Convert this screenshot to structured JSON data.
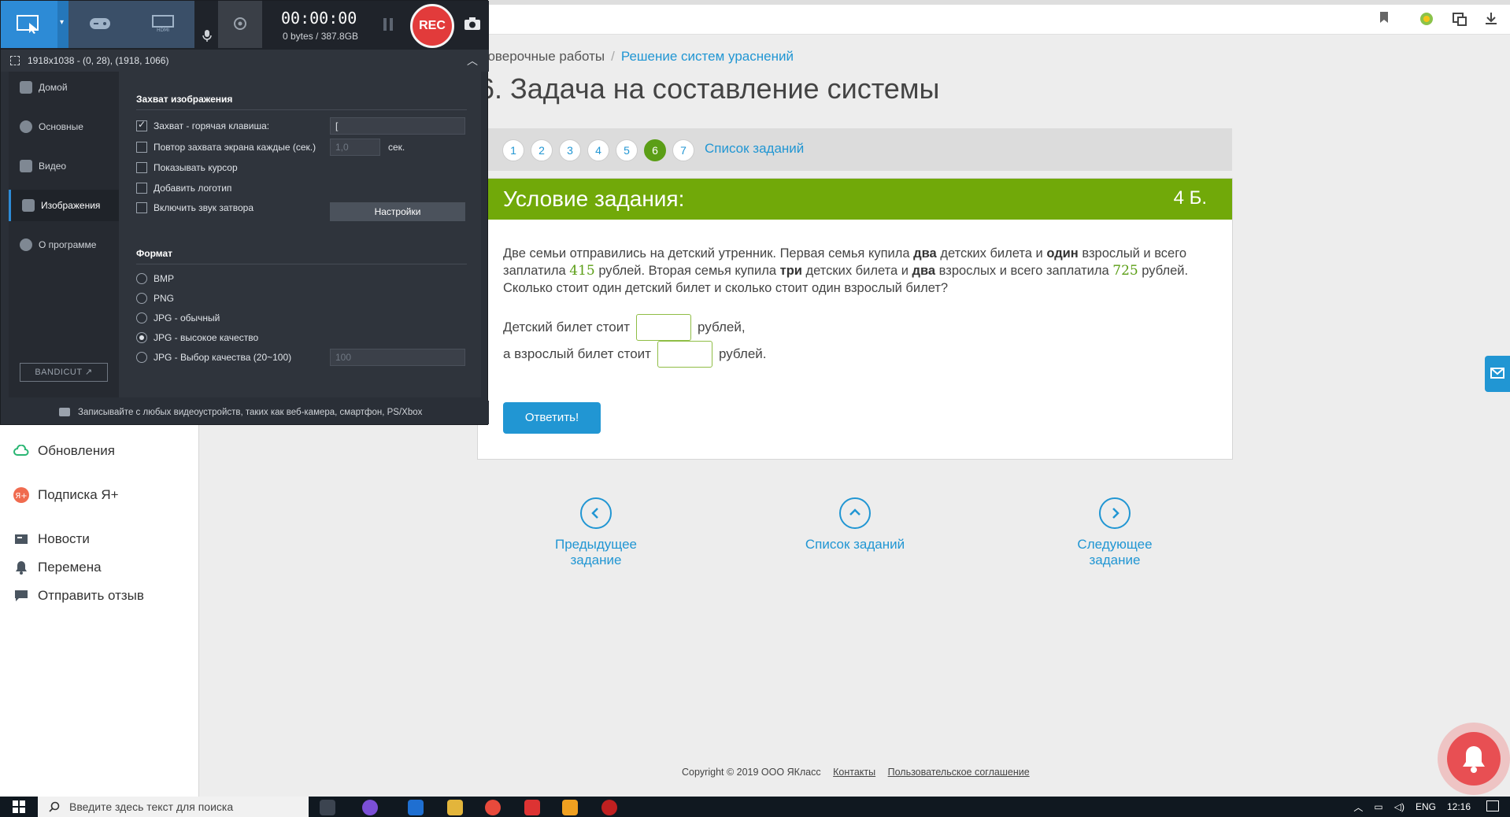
{
  "site": {
    "breadcrumb": {
      "part1": "роверочные работы",
      "separator": "/",
      "part2": "Решение систем урaснений"
    },
    "page_title": "6. Задача на составление системы",
    "tasks": [
      "1",
      "2",
      "3",
      "4",
      "5",
      "6",
      "7"
    ],
    "active_task": "6",
    "task_list_link": "Список заданий",
    "card": {
      "header_title": "Условие задания:",
      "score": "4 Б.",
      "condition": {
        "t1": "Две семьи отправились на детский утренник. Первая семья купила ",
        "b1": "два",
        "t2": " детских билета и ",
        "b2": "один",
        "t3": " взрослый и всего заплатила ",
        "n1": "415",
        "t4": " рублей. Вторая семья купила ",
        "b3": "три",
        "t5": " детских билета и ",
        "b4": "два",
        "t6": " взрослых и всего заплатила ",
        "n2": "725",
        "t7": " рублей. Сколько стоит один детский билет и сколько стоит один взрослый билет?"
      },
      "answer1_prefix": "Детский билет стоит",
      "answer1_suffix": "рублей,",
      "answer2_prefix": "а взрослый билет стоит",
      "answer2_suffix": "рублей.",
      "submit_label": "Ответить!"
    },
    "bottom_nav": {
      "prev": "Предыдущее задание",
      "list": "Список заданий",
      "next": "Следующее задание"
    },
    "footer": {
      "copyright": "Copyright © 2019 ООО ЯКласс",
      "contacts": "Контакты",
      "agreement": "Пользовательское соглашение"
    },
    "sidebar": [
      {
        "label": "Обновления",
        "color": "#2ab673"
      },
      {
        "label": "Подписка Я+",
        "color": "#f06b4f"
      },
      {
        "label": "Новости",
        "color": "#4a5560"
      },
      {
        "label": "Перемена",
        "color": "#4a5560"
      },
      {
        "label": "Отправить отзыв",
        "color": "#4a5560"
      }
    ]
  },
  "bandicam": {
    "timer": "00:00:00",
    "bytes": "0 bytes / 387.8GB",
    "rec_label": "REC",
    "resolution": "1918x1038 - (0, 28), (1918, 1066)",
    "nav": [
      "Домой",
      "Основные",
      "Видео",
      "Изображения",
      "О программе"
    ],
    "active_nav": "Изображения",
    "bandicut": "BANDICUT ↗",
    "section_capture": "Захват изображения",
    "opt_hotkey": "Захват - горячая клавиша:",
    "hotkey_value": "[",
    "opt_repeat": "Повтор захвата экрана каждые (сек.)",
    "repeat_value": "1,0",
    "repeat_unit": "сек.",
    "opt_cursor": "Показывать курсор",
    "opt_logo": "Добавить логотип",
    "opt_sound": "Включить звук затвора",
    "settings_btn": "Настройки",
    "section_format": "Формат",
    "formats": [
      "BMP",
      "PNG",
      "JPG - обычный",
      "JPG - высокое качество",
      "JPG - Выбор качества (20~100)"
    ],
    "selected_format": "JPG - высокое качество",
    "quality_value": "100",
    "bottom_text": "Записывайте с любых видеоустройств, таких как веб-камера, смартфон, PS/Xbox"
  },
  "taskbar": {
    "search_placeholder": "Введите здесь текст для поиска",
    "lang": "ENG",
    "time": "12:16"
  },
  "colors": {
    "accent_green": "#71a909",
    "link_blue": "#2196d3",
    "rec_red": "#e23b3b"
  }
}
